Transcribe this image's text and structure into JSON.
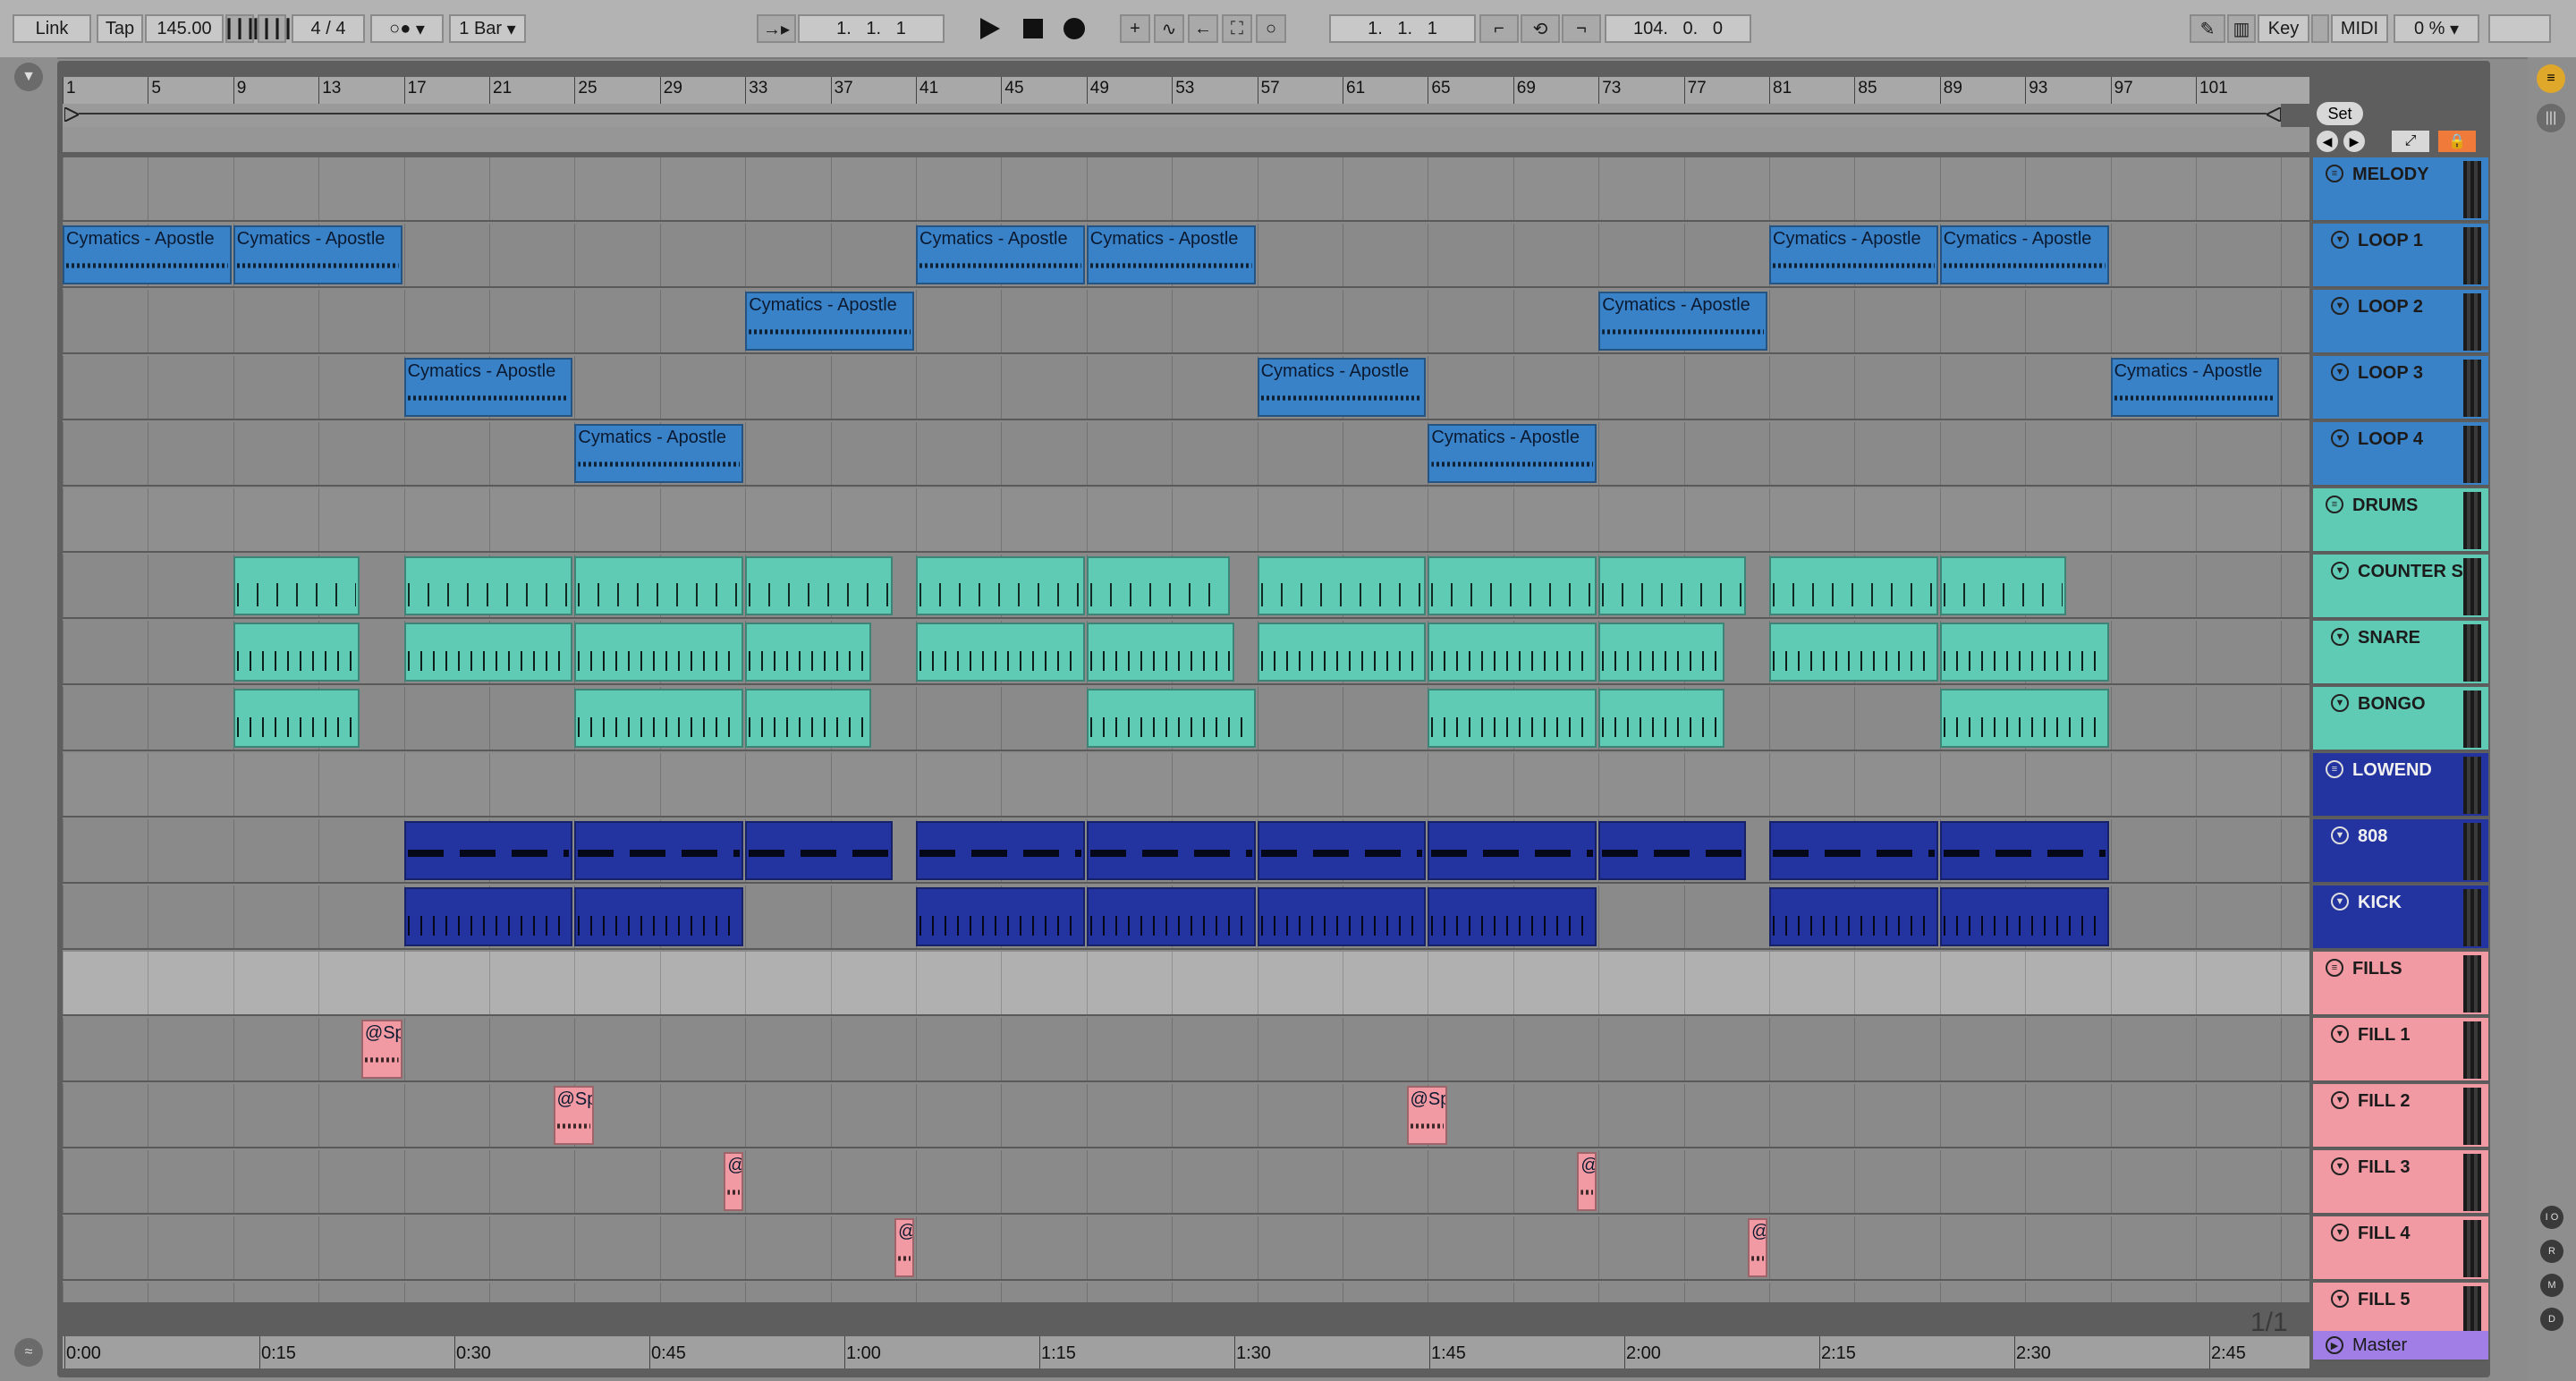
{
  "transport": {
    "link": "Link",
    "tap": "Tap",
    "tempo": "145.00",
    "signature": "4 / 4",
    "metro_mode": "○●",
    "quantize": "1 Bar",
    "position": "1.   1.   1",
    "loop_start": "1.   1.   1",
    "loop_length": "104.   0.   0",
    "key": "Key",
    "midi": "MIDI",
    "cpu": "0 %"
  },
  "set_label": "Set",
  "page_indicator": "1/1",
  "ruler": [
    "1",
    "5",
    "9",
    "13",
    "17",
    "21",
    "25",
    "29",
    "33",
    "37",
    "41",
    "45",
    "49",
    "53",
    "57",
    "61",
    "65",
    "69",
    "73",
    "77",
    "81",
    "85",
    "89",
    "93",
    "97",
    "101"
  ],
  "time_ruler": [
    "0:00",
    "0:15",
    "0:30",
    "0:45",
    "1:00",
    "1:15",
    "1:30",
    "1:45",
    "2:00",
    "2:15",
    "2:30",
    "2:45"
  ],
  "clip_name": "Cymatics - Apostle",
  "fill_clip_name": "@Sp",
  "fill_clip_short": "@",
  "tracks": [
    {
      "name": "MELODY",
      "kind": "group",
      "color": "#3a82c8"
    },
    {
      "name": "LOOP 1",
      "kind": "audio",
      "color": "#3a82c8"
    },
    {
      "name": "LOOP 2",
      "kind": "audio",
      "color": "#3a82c8"
    },
    {
      "name": "LOOP 3",
      "kind": "audio",
      "color": "#3a82c8"
    },
    {
      "name": "LOOP 4",
      "kind": "audio",
      "color": "#3a82c8"
    },
    {
      "name": "DRUMS",
      "kind": "group",
      "color": "#5fcbb5"
    },
    {
      "name": "COUNTER SN",
      "kind": "midi",
      "color": "#5fcbb5"
    },
    {
      "name": "SNARE",
      "kind": "midi",
      "color": "#5fcbb5"
    },
    {
      "name": "BONGO",
      "kind": "midi",
      "color": "#5fcbb5"
    },
    {
      "name": "LOWEND",
      "kind": "group",
      "color": "#2334a0"
    },
    {
      "name": "808",
      "kind": "midi",
      "color": "#2334a0"
    },
    {
      "name": "KICK",
      "kind": "midi",
      "color": "#2334a0"
    },
    {
      "name": "FILLS",
      "kind": "group",
      "color": "#f19aa3"
    },
    {
      "name": "FILL 1",
      "kind": "audio",
      "color": "#f19aa3"
    },
    {
      "name": "FILL 2",
      "kind": "audio",
      "color": "#f19aa3"
    },
    {
      "name": "FILL 3",
      "kind": "audio",
      "color": "#f19aa3"
    },
    {
      "name": "FILL 4",
      "kind": "audio",
      "color": "#f19aa3"
    },
    {
      "name": "FILL 5",
      "kind": "audio",
      "color": "#f19aa3"
    }
  ],
  "master": {
    "name": "Master",
    "color": "#a07ee6"
  },
  "right_icons": [
    "I O",
    "R",
    "M",
    "D"
  ]
}
